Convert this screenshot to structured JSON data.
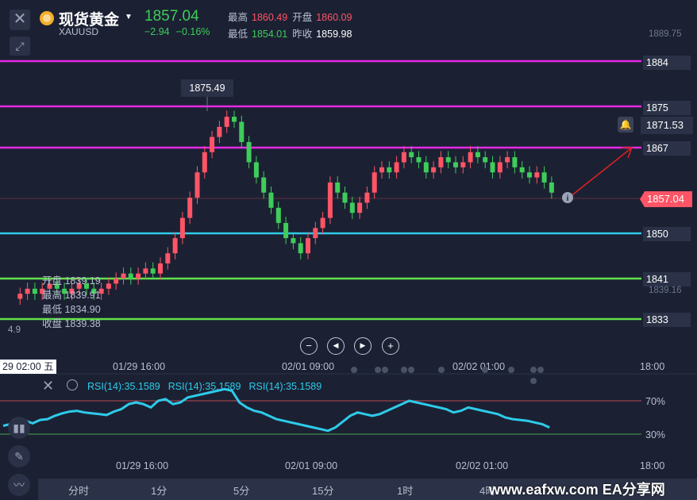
{
  "header": {
    "title": "现货黄金",
    "symbol": "XAUUSD",
    "price": "1857.04",
    "change": "−2.94",
    "change_pct": "−0.16%",
    "high_label": "最高",
    "high_value": "1860.49",
    "open_label": "开盘",
    "open_value": "1860.09",
    "low_label": "最低",
    "low_value": "1854.01",
    "prev_close_label": "昨收",
    "prev_close_value": "1859.98",
    "up_color": "#3fcc5a",
    "down_color": "#ff5566"
  },
  "chart": {
    "top_axis_value": "1889.75",
    "tooltip_high": "1875.49",
    "horizontal_lines": [
      {
        "label": "1884",
        "color": "#e628e6"
      },
      {
        "label": "1875",
        "color": "#e628e6"
      },
      {
        "label": "1867",
        "color": "#e628e6"
      },
      {
        "label": "1850",
        "color": "#2ecbea"
      },
      {
        "label": "1841",
        "color": "#62e04a"
      },
      {
        "label": "1833",
        "color": "#62e04a"
      }
    ],
    "alert_value": "1871.53",
    "current_price": "1857.04",
    "axis_low_value": "1839.16",
    "left_partial_value": "4.9",
    "ohlc": {
      "open": "开盘 1839.19",
      "high": "最高 1839.91",
      "low": "最低 1834.90",
      "close": "收盘 1839.38"
    }
  },
  "nav_buttons": [
    {
      "name": "zoom-out",
      "glyph": "−"
    },
    {
      "name": "scroll-left",
      "glyph": "◀"
    },
    {
      "name": "scroll-right",
      "glyph": "▶"
    },
    {
      "name": "zoom-in",
      "glyph": "+"
    }
  ],
  "time_axis": {
    "cursor_label": "29 02:00 五",
    "labels": [
      "01/29 16:00",
      "02/01 09:00",
      "02/02 01:00",
      "18:00"
    ]
  },
  "rsi": {
    "labels": [
      "RSI(14):35.1589",
      "RSI(14):35.1589",
      "RSI(14):35.1589"
    ],
    "level_high": "70%",
    "level_low": "30%",
    "line_color": "#2ecbea"
  },
  "bottom_axis": [
    "01/29 16:00",
    "02/01 09:00",
    "02/02 01:00",
    "18:00"
  ],
  "timeframes": [
    "分时",
    "1分",
    "5分",
    "15分",
    "1时",
    "4时"
  ],
  "watermark": "www.eafxw.com  EA分享网"
}
